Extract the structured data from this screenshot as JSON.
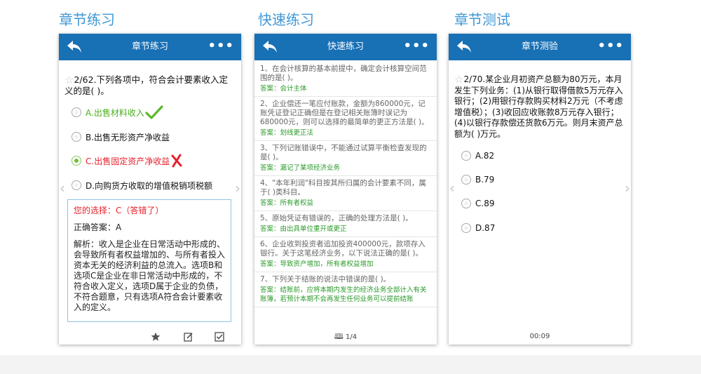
{
  "sections": {
    "chapter_practice": "章节练习",
    "quick_practice": "快速练习",
    "chapter_test": "章节测试"
  },
  "phone1": {
    "title": "章节练习",
    "more": "•••",
    "question": "2/62.下列各项中，符合会计要素收入定义的是(    )。",
    "options": [
      {
        "label": "A.出售材料收入"
      },
      {
        "label": "B.出售无形资产净收益"
      },
      {
        "label": "C.出售固定资产净收益"
      },
      {
        "label": "D.向购货方收取的增值税销项税额"
      }
    ],
    "your_choice": "您的选择：C（答错了）",
    "correct_answer": "正确答案：A",
    "analysis": "解析：收入是企业在日常活动中形成的、会导致所有者权益增加的、与所有者投入资本无关的经济利益的总流入。选项B和选项C是企业在非日常活动中形成的，不符合收入定义，选项D属于企业的负债，不符合题意，只有选项A符合会计要素收入的定义。",
    "colors": {
      "correct": "#4caf1e",
      "wrong": "#e8202a"
    }
  },
  "phone2": {
    "title": "快速练习",
    "more": "•••",
    "items": [
      {
        "q": "1、在会计核算的基本前提中，确定会计核算空间范围的是( )。",
        "a": "答案：会计主体"
      },
      {
        "q": "2、企业偿还一笔应付账款，金额为860000元，记账凭证登记正确但是在登记相关账簿时误记为680000元，则可以选择的最简单的更正方法是( )。",
        "a": "答案：划线更正法"
      },
      {
        "q": "3、下列记账错误中，不能通过试算平衡检查发现的是( )。",
        "a": "答案：漏记了某项经济业务"
      },
      {
        "q": "4、\"本年利润\"科目按其所归属的会计要素不同，属于( )类科目。",
        "a": "答案：所有者权益"
      },
      {
        "q": "5、原始凭证有错误的，正确的处理方法是( )。",
        "a": "答案：由出具单位重开或更正"
      },
      {
        "q": "6、企业收到投资者追加投资400000元，款项存入银行。关于这笔经济业务，以下说法正确的是( )。",
        "a": "答案：导致资产增加，所有者权益增加"
      },
      {
        "q": "7、下列关于结账的说法中错误的是( )。",
        "a": "答案：结账前，应将本期内发生的经济业务全部计入有关账簿，若预计本期不会再发生任何业务可以提前结账"
      }
    ],
    "page": "1/4"
  },
  "phone3": {
    "title": "章节测验",
    "more": "•••",
    "question": "2/70.某企业月初资产总额为80万元，本月发生下列业务：(1)从银行取得借款5万元存入银行；(2)用银行存款购买材料2万元（不考虑增值税）；(3)收回应收账款8万元存入银行；(4)以银行存款偿还货款6万元。则月末资产总额为(    )万元。",
    "options": [
      {
        "label": "A.82"
      },
      {
        "label": "B.79"
      },
      {
        "label": "C.89"
      },
      {
        "label": "D.87"
      }
    ],
    "timer": "00:09"
  }
}
